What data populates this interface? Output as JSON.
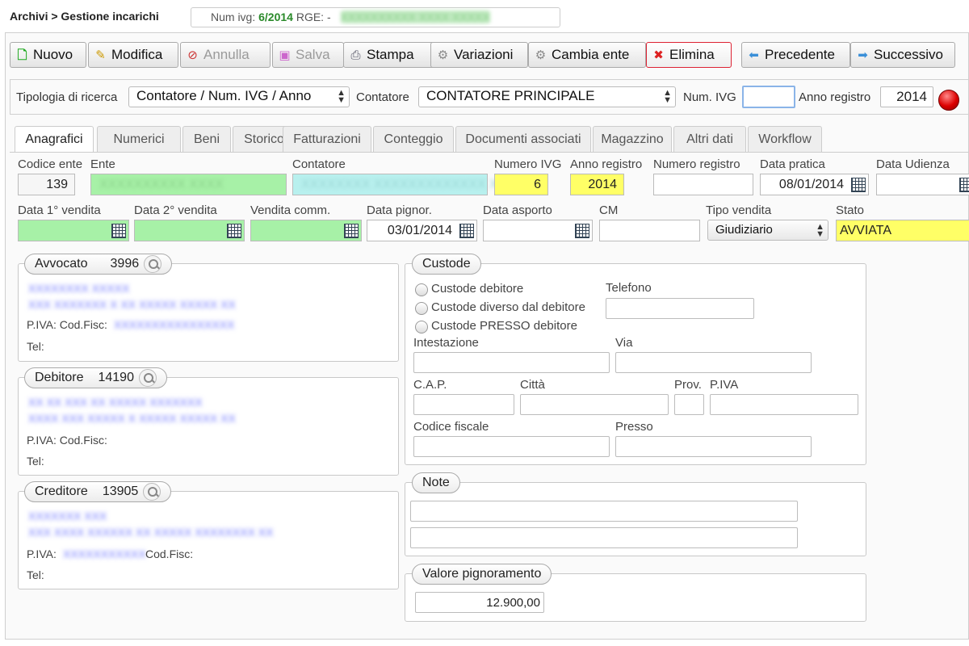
{
  "header": {
    "breadcrumb": "Archivi > Gestione incarichi",
    "ivg_prefix": "Num ivg:",
    "ivg_value": "6/2014",
    "rge_label": "RGE: -",
    "rge_value": "XXXXXXXXXX XXXX XXXXX"
  },
  "toolbar": {
    "nuovo": "Nuovo",
    "modifica": "Modifica",
    "annulla": "Annulla",
    "salva": "Salva",
    "stampa": "Stampa",
    "variazioni": "Variazioni",
    "cambia_ente": "Cambia ente",
    "elimina": "Elimina",
    "precedente": "Precedente",
    "successivo": "Successivo"
  },
  "search": {
    "tipologia_label": "Tipologia di ricerca",
    "tipologia_value": "Contatore / Num. IVG / Anno",
    "contatore_label": "Contatore",
    "contatore_value": "CONTATORE PRINCIPALE",
    "numivg_label": "Num. IVG",
    "numivg_value": "",
    "anno_label": "Anno registro",
    "anno_value": "2014"
  },
  "tabs": [
    "Anagrafici",
    "Numerici",
    "Beni",
    "Storico",
    "Fatturazioni",
    "Conteggio",
    "Documenti associati",
    "Magazzino",
    "Altri dati",
    "Workflow"
  ],
  "fields": {
    "codice_ente_label": "Codice ente",
    "codice_ente": "139",
    "ente_label": "Ente",
    "ente": "XXXXXXXXXX XXXX",
    "contatore_label": "Contatore",
    "contatore": "XXXXXXXX XXXXXXXXXXXXX XX",
    "numero_ivg_label": "Numero IVG",
    "numero_ivg": "6",
    "anno_registro_label": "Anno registro",
    "anno_registro": "2014",
    "numero_registro_label": "Numero registro",
    "numero_registro": "",
    "data_pratica_label": "Data pratica",
    "data_pratica": "08/01/2014",
    "data_udienza_label": "Data Udienza",
    "data_udienza": "",
    "data1_label": "Data 1° vendita",
    "data2_label": "Data 2° vendita",
    "vendita_comm_label": "Vendita comm.",
    "data_pignor_label": "Data pignor.",
    "data_pignor": "03/01/2014",
    "data_asporto_label": "Data asporto",
    "cm_label": "CM",
    "tipo_vendita_label": "Tipo vendita",
    "tipo_vendita": "Giudiziario",
    "stato_label": "Stato",
    "stato": "AVVIATA"
  },
  "avvocato": {
    "title": "Avvocato",
    "code": "3996",
    "line1": "XXXXXXXX XXXXX",
    "line2": "XXX XXXXXXX X XX XXXXX XXXXX XX",
    "piva_label": "P.IVA: Cod.Fisc:",
    "piva": "XXXXXXXXXXXXXXXX",
    "tel_label": "Tel:"
  },
  "debitore": {
    "title": "Debitore",
    "code": "14190",
    "line1": "XX XX XXX XX XXXXX XXXXXXX",
    "line2": "XXXX XXX XXXXX X XXXXX XXXXX XX",
    "piva_label": "P.IVA: Cod.Fisc:",
    "tel_label": "Tel:"
  },
  "creditore": {
    "title": "Creditore",
    "code": "13905",
    "line1": "XXXXXXX XXX",
    "line2": "XXX XXXX XXXXXX XX XXXXX XXXXXXXX XX",
    "piva_label": "P.IVA:",
    "piva": "XXXXXXXXXXX",
    "codfisc_label": "Cod.Fisc:",
    "tel_label": "Tel:"
  },
  "custode": {
    "title": "Custode",
    "opt1": "Custode debitore",
    "opt2": "Custode diverso dal debitore",
    "opt3": "Custode PRESSO debitore",
    "telefono_label": "Telefono",
    "intestazione_label": "Intestazione",
    "via_label": "Via",
    "cap_label": "C.A.P.",
    "citta_label": "Città",
    "prov_label": "Prov.",
    "piva_label": "P.IVA",
    "codfisc_label": "Codice fiscale",
    "presso_label": "Presso"
  },
  "note": {
    "title": "Note"
  },
  "valore": {
    "title": "Valore pignoramento",
    "value": "12.900,00"
  }
}
